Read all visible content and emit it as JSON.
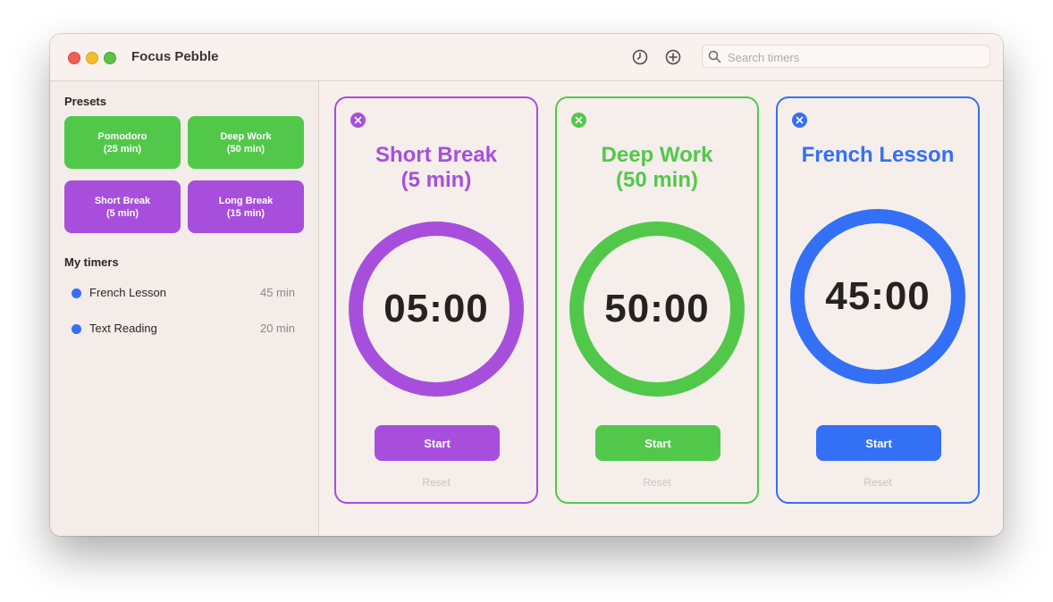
{
  "app": {
    "title": "Focus Pebble"
  },
  "toolbar": {
    "history_icon": "clock-icon",
    "add_icon": "plus-circle-icon",
    "search_placeholder": "Search timers",
    "search_value": ""
  },
  "sidebar": {
    "presets_title": "Presets",
    "presets": [
      {
        "label": "Pomodoro\n(25 min)",
        "color": "#52c84a"
      },
      {
        "label": "Deep Work\n(50 min)",
        "color": "#52c84a"
      },
      {
        "label": "Short Break\n(5 min)",
        "color": "#a74fdc"
      },
      {
        "label": "Long Break\n(15 min)",
        "color": "#a74fdc"
      }
    ],
    "my_timers_title": "My timers",
    "my_timers": [
      {
        "name": "French Lesson",
        "duration": "45 min",
        "color": "#3470f5"
      },
      {
        "name": "Text Reading",
        "duration": "20 min",
        "color": "#3470f5"
      }
    ]
  },
  "cards": [
    {
      "title": "Short Break\n(5 min)",
      "time": "05:00",
      "color": "#a74fdc",
      "start_label": "Start",
      "reset_label": "Reset"
    },
    {
      "title": "Deep Work\n(50 min)",
      "time": "50:00",
      "color": "#52c84a",
      "start_label": "Start",
      "reset_label": "Reset"
    },
    {
      "title": "French Lesson",
      "time": "45:00",
      "color": "#3470f5",
      "start_label": "Start",
      "reset_label": "Reset"
    }
  ]
}
